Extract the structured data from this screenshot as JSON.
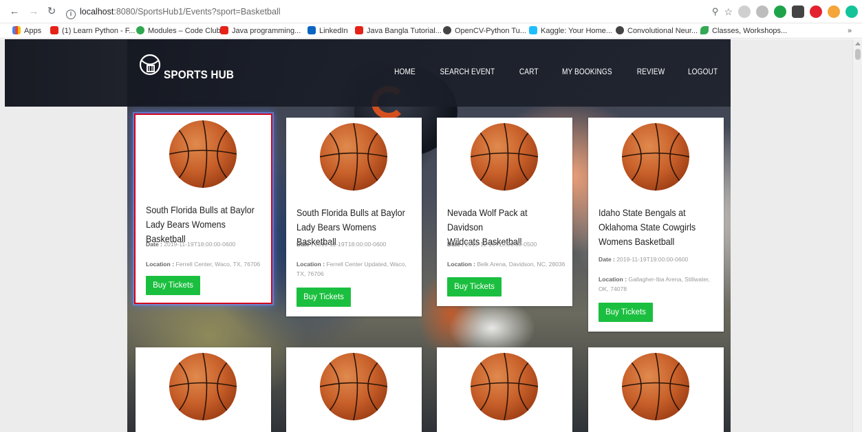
{
  "browser": {
    "url_host": "localhost",
    "url_path": ":8080/SportsHub1/Events?sport=Basketball",
    "bookmarks": [
      {
        "label": "Apps",
        "color": "#4285f4"
      },
      {
        "label": "(1) Learn Python - F...",
        "color": "#e62117"
      },
      {
        "label": "Modules – Code Club",
        "color": "#2fa84f"
      },
      {
        "label": "Java programming...",
        "color": "#e62117"
      },
      {
        "label": "LinkedIn",
        "color": "#0a66c2"
      },
      {
        "label": "Java Bangla Tutorial...",
        "color": "#e62117"
      },
      {
        "label": "OpenCV-Python Tu...",
        "color": "#444444"
      },
      {
        "label": "Kaggle: Your Home...",
        "color": "#20beff"
      },
      {
        "label": "Convolutional Neur...",
        "color": "#444444"
      },
      {
        "label": "Classes, Workshops...",
        "color": "#34a853"
      }
    ],
    "more_bookmarks": "»"
  },
  "site": {
    "brand": "SPORTS HUB",
    "nav": [
      "HOME",
      "SEARCH EVENT",
      "CART",
      "MY BOOKINGS",
      "REVIEW",
      "LOGOUT"
    ]
  },
  "events": [
    {
      "title": "South Florida Bulls at Baylor\nLady Bears Womens Basketball",
      "date_label": "Date :",
      "date": "2019-11-19T18:00:00-0600",
      "location_label": "Location :",
      "location": "Ferrell Center, Waco, TX, 76706",
      "button": "Buy Tickets"
    },
    {
      "title": "South Florida Bulls at Baylor\nLady Bears Womens Basketball",
      "date_label": "Date :",
      "date": "2019-11-19T18:00:00-0600",
      "location_label": "Location :",
      "location": "Ferrell Center Updated, Waco, TX, 76706",
      "button": "Buy Tickets"
    },
    {
      "title": "Nevada Wolf Pack at Davidson\nWildcats Basketball",
      "date_label": "Date :",
      "date": "2019-11-19T19:00:00-0500",
      "location_label": "Location :",
      "location": "Belk Arena, Davidson, NC, 28036",
      "button": "Buy Tickets"
    },
    {
      "title": "Idaho State Bengals at\nOklahoma State Cowgirls\nWomens Basketball",
      "date_label": "Date :",
      "date": "2019-11-19T19:00:00-0600",
      "location_label": "Location :",
      "location": "Gallagher-Iba Arena, Stillwater, OK, 74078",
      "button": "Buy Tickets"
    }
  ],
  "colors": {
    "buy_button": "#1bbf3f",
    "selection_outline": "#d0021b"
  }
}
